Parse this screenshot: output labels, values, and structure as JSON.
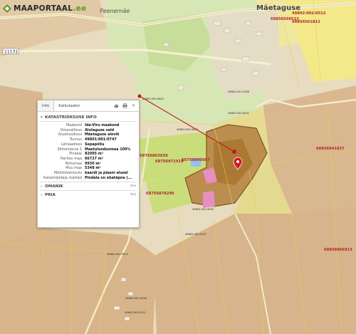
{
  "logo": {
    "brand": "MAAPORTAAL",
    "suffix": ".ee",
    "brand_color": "#5a9a2e"
  },
  "map": {
    "place_labels": [
      "Peenemäe",
      "Mäetaguse"
    ],
    "road_number": "11131",
    "parcel_ids_map": [
      "49802:002:0512",
      "68856561812",
      "68856568513",
      "68856941837",
      "68856866913",
      "68756863658",
      "68756971918",
      "68756890067",
      "68756878296",
      "49802:002:0005",
      "49802:002:0121",
      "49802:002:0012",
      "49802:002:0035",
      "49802:002:0036",
      "49802:002:0121",
      "49802:001:0768",
      "49802:002:0042",
      "49802:002:0031"
    ],
    "highlight_parcel_color": "#a8742c",
    "marker_color": "#d7191c"
  },
  "panel": {
    "tabs": [
      {
        "label": "Info",
        "active": true
      },
      {
        "label": "Kalkulaator",
        "active": false
      }
    ],
    "tools": [
      "thumbs-up-icon",
      "print-icon",
      "close-icon"
    ],
    "section_title": "KATASTRIÜKSUSE INFO",
    "rows": [
      {
        "key": "Maakond",
        "value": "Ida-Viru maakond"
      },
      {
        "key": "Omavalitsus",
        "value": "Alutaguse vald"
      },
      {
        "key": "Asustusüksus",
        "value": "Mäetaguse alevik"
      },
      {
        "key": "Tunnus",
        "value": "49801:001:0747"
      },
      {
        "key": "Lähiaadress",
        "value": "Sepapõllu"
      },
      {
        "key": "Sihtotstarve 1",
        "value": "Maatulundusmaa 100%"
      },
      {
        "key": "Pindala",
        "value": "82005 m²"
      },
      {
        "key": "Haritav maa",
        "value": "66727 m²"
      },
      {
        "key": "Rohumaa",
        "value": "9930 m²"
      },
      {
        "key": "Muu maa",
        "value": "5348 m²"
      },
      {
        "key": "Mõõdistamisviis",
        "value": "kaardi ja plaani alusel"
      },
      {
        "key": "Katastripidaja märked",
        "value": "Pindala on ebatäpne (..."
      }
    ],
    "sections": [
      {
        "title": "OMANIK",
        "more": "Ava"
      },
      {
        "title": "PRIA",
        "more": "Ava"
      }
    ]
  }
}
